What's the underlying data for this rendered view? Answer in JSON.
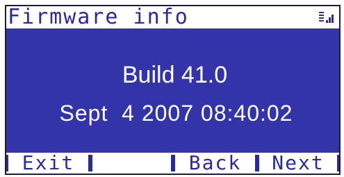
{
  "header": {
    "title": "Firmware info",
    "icons": [
      "menu-list-icon",
      "signal-icon"
    ]
  },
  "main": {
    "build": "Build 41.0",
    "date": "Sept  4 2007 08:40:02"
  },
  "softkeys": [
    {
      "label": "Exit"
    },
    {
      "label": ""
    },
    {
      "label": "Back"
    },
    {
      "label": "Next"
    }
  ],
  "colors": {
    "screen_background": "#3333aa",
    "bar_background": "#ffffff",
    "bar_text": "#2a2a9a",
    "content_text": "#ffffff"
  }
}
